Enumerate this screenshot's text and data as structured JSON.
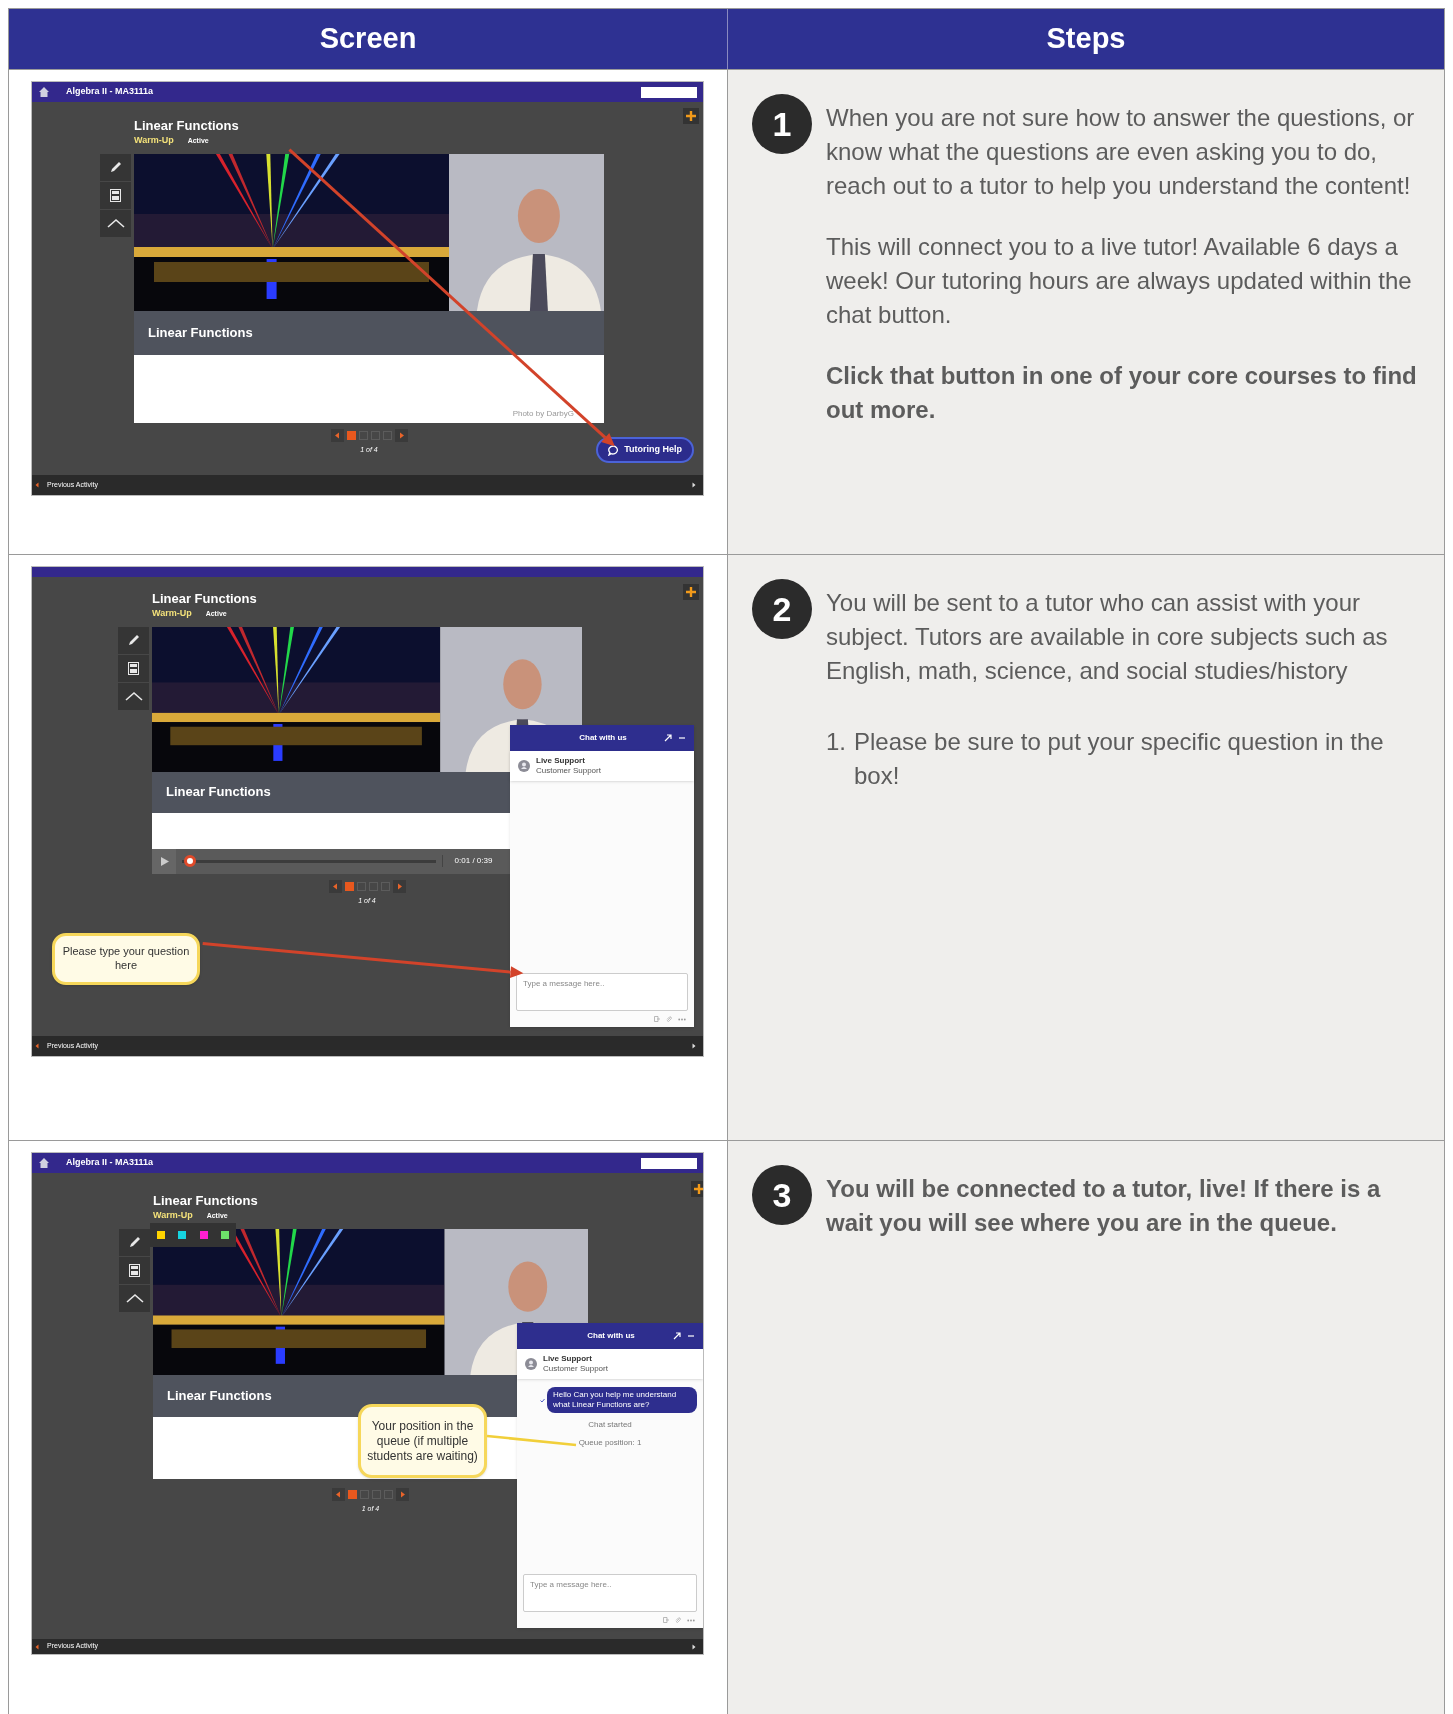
{
  "table": {
    "columns": [
      {
        "label": "Screen"
      },
      {
        "label": "Steps"
      }
    ],
    "rows": [
      {
        "screen": {
          "course_title": "Algebra II - MA3111a",
          "heading": "Linear Functions",
          "tag": "Warm-Up",
          "status": "Active",
          "slide_title": "Linear Functions",
          "photo_credit": "Photo by DarbyG",
          "pages": [
            {
              "selected": true
            },
            {
              "selected": false
            },
            {
              "selected": false
            },
            {
              "selected": false
            }
          ],
          "counter": "1 of 4",
          "help_button": "Tutoring Help",
          "footer": "Previous Activity"
        },
        "step": {
          "number": "1",
          "paragraphs": [
            {
              "kind": "text",
              "text": "When you are not sure how to answer the questions, or know what the questions are even asking you to do, reach out to a tutor to help you understand the content!"
            },
            {
              "kind": "text",
              "text": "This will connect you to a live tutor! Available 6 days a week! Our tutoring hours are always updated within the chat button."
            },
            {
              "kind": "bold",
              "text": "Click that button in one of your core courses to find out more."
            }
          ]
        }
      },
      {
        "screen": {
          "heading": "Linear Functions",
          "tag": "Warm-Up",
          "status": "Active",
          "slide_title": "Linear Functions",
          "video": {
            "time": "0:01 / 0:39",
            "level": 0.03
          },
          "pages": [
            {
              "selected": true
            },
            {
              "selected": false
            },
            {
              "selected": false
            },
            {
              "selected": false
            }
          ],
          "counter": "1 of 4",
          "chat": {
            "title": "Chat with us",
            "agent": "Live Support",
            "agent_role": "Customer Support",
            "placeholder": "Type a message here.."
          },
          "callout": "Please type your question here",
          "footer": "Previous Activity"
        },
        "step": {
          "number": "2",
          "paragraphs": [
            {
              "kind": "text",
              "text": "You will be sent to a tutor who can assist with your subject. Tutors are available in core subjects such as English, math, science, and social studies/history"
            },
            {
              "kind": "list_item",
              "marker": "1.",
              "text": "Please be sure to put your specific question in the box!"
            }
          ]
        }
      },
      {
        "screen": {
          "course_title": "Algebra II - MA3111a",
          "heading": "Linear Functions",
          "tag": "Warm-Up",
          "status": "Active",
          "slide_title": "Linear Functions",
          "palette": [
            {
              "color": "#ffd400"
            },
            {
              "color": "#16d4e0"
            },
            {
              "color": "#ff1fd0"
            },
            {
              "color": "#6ee06a"
            }
          ],
          "pages": [
            {
              "selected": true
            },
            {
              "selected": false
            },
            {
              "selected": false
            },
            {
              "selected": false
            }
          ],
          "counter": "1 of 4",
          "chat": {
            "title": "Chat with us",
            "agent": "Live Support",
            "agent_role": "Customer Support",
            "messages": [
              {
                "text": "Hello Can you help me understand what Linear Functions are?"
              }
            ],
            "events": [
              {
                "text": "Chat started"
              },
              {
                "text": "Queue position: 1"
              }
            ],
            "placeholder": "Type a message here.."
          },
          "callout": "Your position in the queue (if multiple students are waiting)",
          "footer": "Previous Activity"
        },
        "step": {
          "number": "3",
          "paragraphs": [
            {
              "kind": "bold",
              "text": "You will be connected to a tutor, live! If there is a wait you will see where you are in the queue."
            }
          ]
        }
      }
    ]
  }
}
